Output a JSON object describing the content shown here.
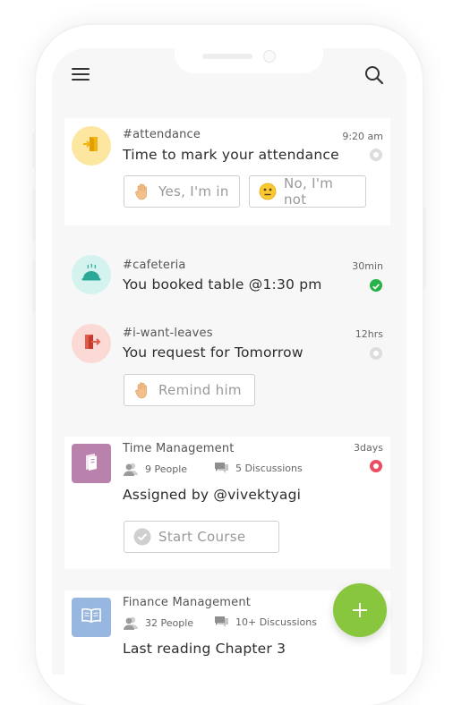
{
  "feed": {
    "attendance": {
      "channel": "#attendance",
      "time": "9:20 am",
      "title": "Time to mark your attendance",
      "yes_label": "Yes, I'm in",
      "no_label": "No, I'm not"
    },
    "cafeteria": {
      "channel": "#cafeteria",
      "time": "30min",
      "title": "You booked table @1:30 pm"
    },
    "leaves": {
      "channel": "#i-want-leaves",
      "time": "12hrs",
      "title": "You request for Tomorrow",
      "remind_label": "Remind him"
    },
    "course1": {
      "name": "Time Management",
      "time": "3days",
      "people": "9 People",
      "discussions": "5 Discussions",
      "title": "Assigned by @vivektyagi",
      "start_label": "Start Course"
    },
    "course2": {
      "name": "Finance Management",
      "people": "32 People",
      "discussions": "10+ Discussions",
      "title": "Last reading Chapter 3"
    }
  },
  "colors": {
    "accent_green": "#88c63d",
    "status_green": "#27b24a",
    "status_red": "#ec4d63",
    "attendance_avatar": "#fde7a0",
    "cafeteria_avatar": "#d4f3ef",
    "leaves_avatar": "#fbd9d4",
    "course1_thumb": "#b882ad",
    "course2_thumb": "#98b7e0"
  },
  "icons": {
    "menu": "hamburger-icon",
    "search": "search-icon",
    "attendance": "door-enter-icon",
    "cafeteria": "cloche-icon",
    "leaves": "door-exit-icon",
    "course1": "book-icon",
    "course2": "open-book-icon",
    "fab": "plus-icon"
  }
}
